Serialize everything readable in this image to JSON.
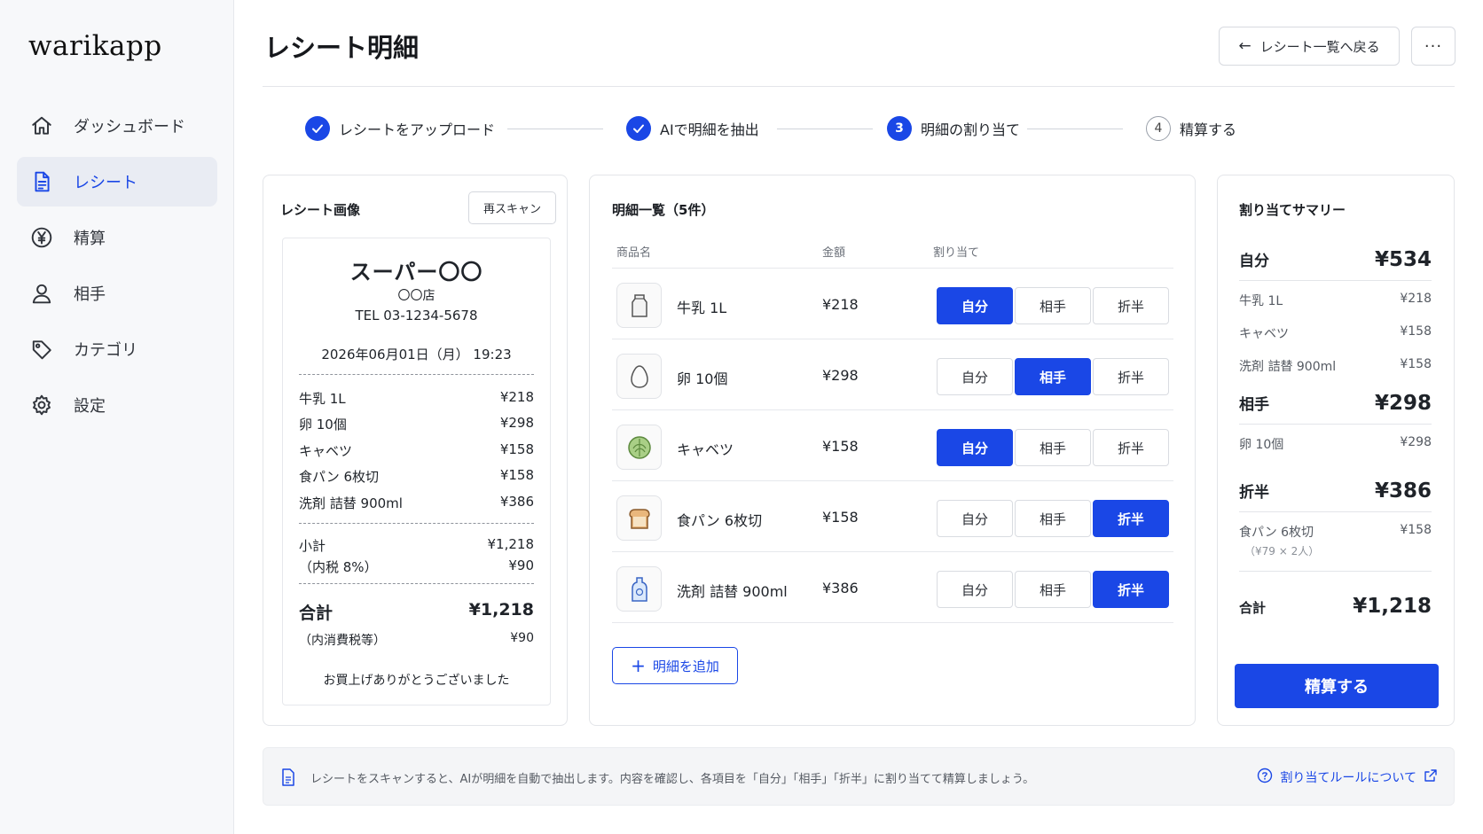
{
  "app": {
    "logo": "warikapp"
  },
  "sidebar": {
    "items": [
      {
        "label": "ダッシュボード",
        "icon": "home-icon"
      },
      {
        "label": "レシート",
        "icon": "receipt-icon",
        "active": true
      },
      {
        "label": "精算",
        "icon": "yen-circle-icon"
      },
      {
        "label": "相手",
        "icon": "user-icon"
      },
      {
        "label": "カテゴリ",
        "icon": "tag-icon"
      },
      {
        "label": "設定",
        "icon": "gear-icon"
      }
    ]
  },
  "header": {
    "title": "レシート明細",
    "back_label": "レシート一覧へ戻る",
    "more_label": "···"
  },
  "steps": [
    {
      "label": "レシートをアップロード",
      "status": "done",
      "num": ""
    },
    {
      "label": "AIで明細を抽出",
      "status": "done",
      "num": ""
    },
    {
      "label": "明細の割り当て",
      "status": "current",
      "num": "3"
    },
    {
      "label": "精算する",
      "status": "todo",
      "num": "4"
    }
  ],
  "receipt_panel": {
    "title": "レシート画像",
    "rescan_label": "再スキャン",
    "store": "スーパー〇〇",
    "branch": "〇〇店",
    "tel": "TEL  03-1234-5678",
    "datetime": "2026年06月01日（月） 19:23",
    "lines": [
      {
        "name": "牛乳 1L",
        "price": "¥218"
      },
      {
        "name": "卵 10個",
        "price": "¥298"
      },
      {
        "name": "キャベツ",
        "price": "¥158"
      },
      {
        "name": "食パン 6枚切",
        "price": "¥158"
      },
      {
        "name": "洗剤 詰替 900ml",
        "price": "¥386"
      }
    ],
    "subtotal_label": "小計",
    "subtotal": "¥1,218",
    "tax_label": "（内税 8%）",
    "tax": "¥90",
    "total_label": "合計",
    "total": "¥1,218",
    "total_tax_label": "（内消費税等）",
    "total_tax": "¥90",
    "thanks": "お買上げありがとうございました"
  },
  "items_panel": {
    "title": "明細一覧（5件）",
    "col_name": "商品名",
    "col_price": "金額",
    "col_assign": "割り当て",
    "options": [
      "自分",
      "相手",
      "折半"
    ],
    "items": [
      {
        "name": "牛乳 1L",
        "price": "¥218",
        "icon": "milk-icon",
        "assigned": "自分"
      },
      {
        "name": "卵 10個",
        "price": "¥298",
        "icon": "egg-icon",
        "assigned": "相手"
      },
      {
        "name": "キャベツ",
        "price": "¥158",
        "icon": "cabbage-icon",
        "assigned": "自分"
      },
      {
        "name": "食パン 6枚切",
        "price": "¥158",
        "icon": "bread-icon",
        "assigned": "折半"
      },
      {
        "name": "洗剤 詰替 900ml",
        "price": "¥386",
        "icon": "detergent-icon",
        "assigned": "折半"
      }
    ],
    "add_label": "明細を追加"
  },
  "summary": {
    "title": "割り当てサマリー",
    "groups": [
      {
        "label": "自分",
        "amount": "¥534",
        "rows": [
          {
            "name": "牛乳 1L",
            "price": "¥218"
          },
          {
            "name": "キャベツ",
            "price": "¥158"
          },
          {
            "name": "洗剤 詰替 900ml",
            "price": "¥158"
          }
        ]
      },
      {
        "label": "相手",
        "amount": "¥298",
        "rows": [
          {
            "name": "卵 10個",
            "price": "¥298"
          }
        ]
      },
      {
        "label": "折半",
        "amount": "¥386",
        "rows": [
          {
            "name": "食パン 6枚切",
            "price": "¥158",
            "sub": "（¥79 × 2人）"
          }
        ]
      }
    ],
    "total_label": "合計",
    "total": "¥1,218",
    "pay_label": "精算する"
  },
  "info": {
    "text": "レシートをスキャンすると、AIが明細を自動で抽出します。内容を確認し、各項目を「自分」「相手」「折半」に割り当てて精算しましょう。",
    "link": "割り当てルールについて"
  },
  "colors": {
    "accent": "#1a47e6",
    "border": "#e3e5e9",
    "sidebar_bg": "#f7f8fa"
  }
}
